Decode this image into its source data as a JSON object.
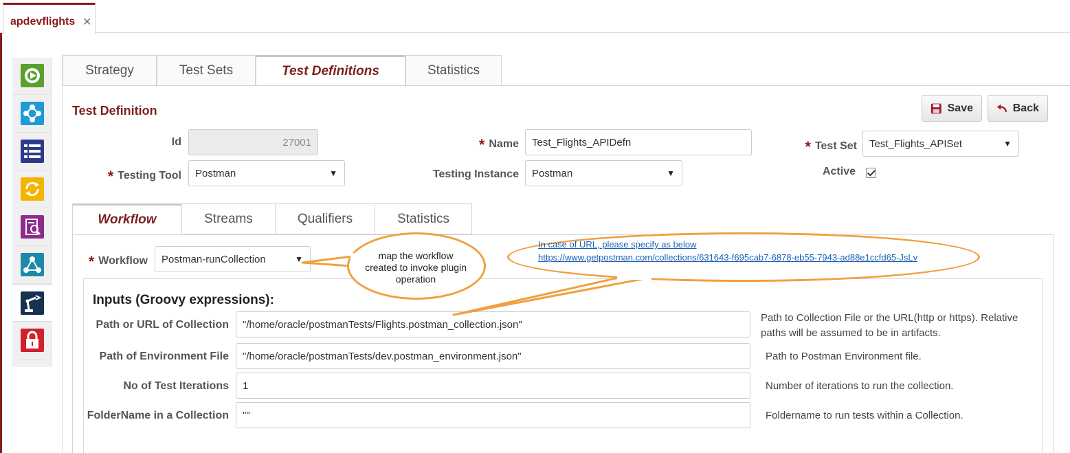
{
  "doc_tab": {
    "label": "apdevflights",
    "close": "✕"
  },
  "rail": {
    "items": [
      {
        "icon": "deploy-icon",
        "color": "#5aa02c"
      },
      {
        "icon": "network-icon",
        "color": "#1e9ad6"
      },
      {
        "icon": "list-icon",
        "color": "#2d3a8c"
      },
      {
        "icon": "refresh-icon",
        "color": "#f4b400"
      },
      {
        "icon": "report-icon",
        "color": "#8e2a8a"
      },
      {
        "icon": "topology-icon",
        "color": "#1e8aa8"
      },
      {
        "icon": "robot-arm-icon",
        "color": "#16324f"
      },
      {
        "icon": "lock-icon",
        "color": "#d0202a"
      }
    ]
  },
  "tabs": [
    {
      "label": "Strategy"
    },
    {
      "label": "Test Sets"
    },
    {
      "label": "Test Definitions"
    },
    {
      "label": "Statistics"
    }
  ],
  "section_title": "Test Definition",
  "buttons": {
    "save": "Save",
    "back": "Back"
  },
  "form": {
    "required_mark": "*",
    "id_label": "Id",
    "id_value": "27001",
    "name_label": "Name",
    "name_value": "Test_Flights_APIDefn",
    "testset_label": "Test Set",
    "testset_value": "Test_Flights_APISet",
    "tool_label": "Testing Tool",
    "tool_value": "Postman",
    "instance_label": "Testing Instance",
    "instance_value": "Postman",
    "active_label": "Active",
    "caret": "▼"
  },
  "inner_tabs": [
    {
      "label": "Workflow"
    },
    {
      "label": "Streams"
    },
    {
      "label": "Qualifiers"
    },
    {
      "label": "Statistics"
    }
  ],
  "workflow": {
    "label": "Workflow",
    "value": "Postman-runCollection"
  },
  "inputs": {
    "title": "Inputs (Groovy expressions):",
    "rows": [
      {
        "label": "Path or URL of Collection",
        "value": "\"/home/oracle/postmanTests/Flights.postman_collection.json\"",
        "hint": "Path to Collection File or the URL(http or https). Relative paths will be assumed to be in artifacts."
      },
      {
        "label": "Path of Environment File",
        "value": "\"/home/oracle/postmanTests/dev.postman_environment.json\"",
        "hint": "Path to Postman Environment file."
      },
      {
        "label": "No of Test Iterations",
        "value": "1",
        "hint": "Number of iterations to run the collection."
      },
      {
        "label": "FolderName in a Collection",
        "value": "\"\"",
        "hint": "Foldername to run tests within a Collection."
      }
    ]
  },
  "callouts": {
    "workflow_note": "map the workflow created to invoke plugin operation",
    "url_line1": "In case of URL, please specify as below",
    "url_line2": "https://www.getpostman.com/collections/631643-f695cab7-6878-eb55-7943-ad88e1ccfd65-JsLv",
    "border_color": "#f0a040"
  },
  "colors": {
    "brand": "#8b1a1a",
    "link": "#1a5fb4"
  }
}
